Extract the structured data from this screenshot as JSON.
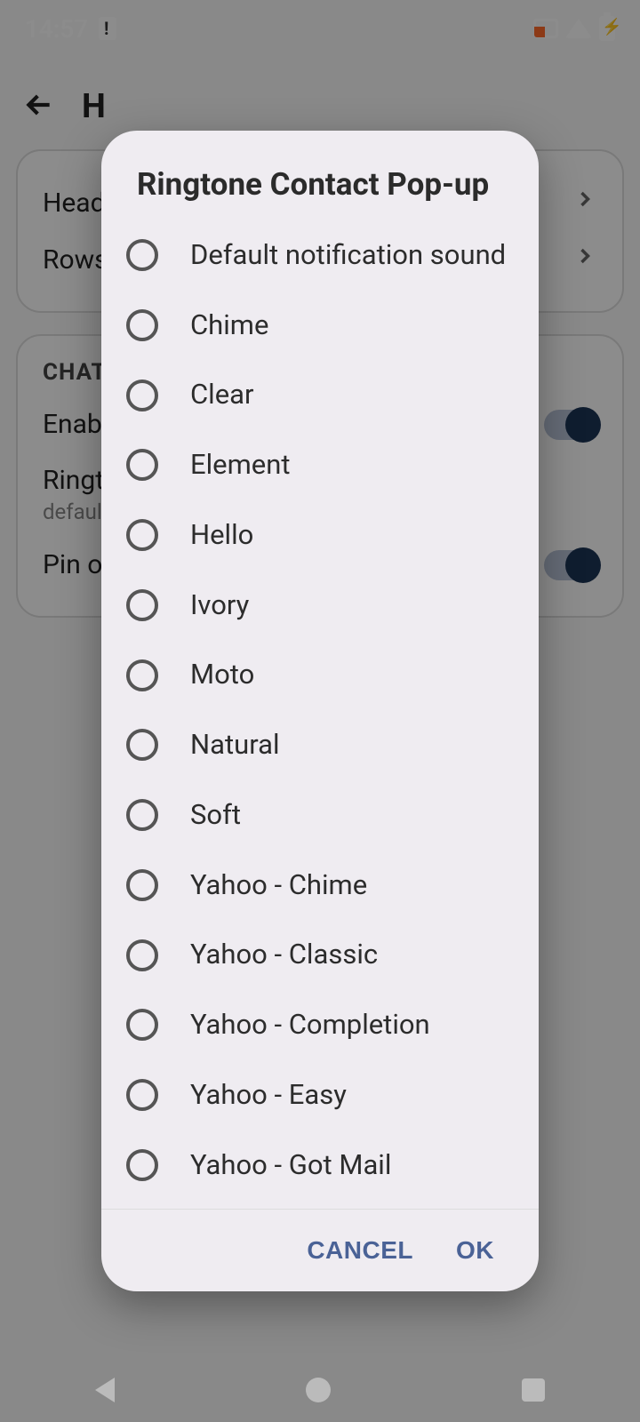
{
  "status": {
    "time": "14:57"
  },
  "bg": {
    "title": "H",
    "card1": {
      "row1": "Head",
      "row2": "Rows"
    },
    "card2": {
      "section": "CHAT",
      "row1": "Enabl",
      "row2": "Ringt",
      "row2sub": "defaul",
      "row3": "Pin ov"
    }
  },
  "dialog": {
    "title": "Ringtone Contact Pop-up",
    "options": [
      "Default notification sound",
      "Chime",
      "Clear",
      "Element",
      "Hello",
      "Ivory",
      "Moto",
      "Natural",
      "Soft",
      "Yahoo - Chime",
      "Yahoo - Classic",
      "Yahoo - Completion",
      "Yahoo - Easy",
      "Yahoo - Got Mail"
    ],
    "cancel": "CANCEL",
    "ok": "OK"
  }
}
